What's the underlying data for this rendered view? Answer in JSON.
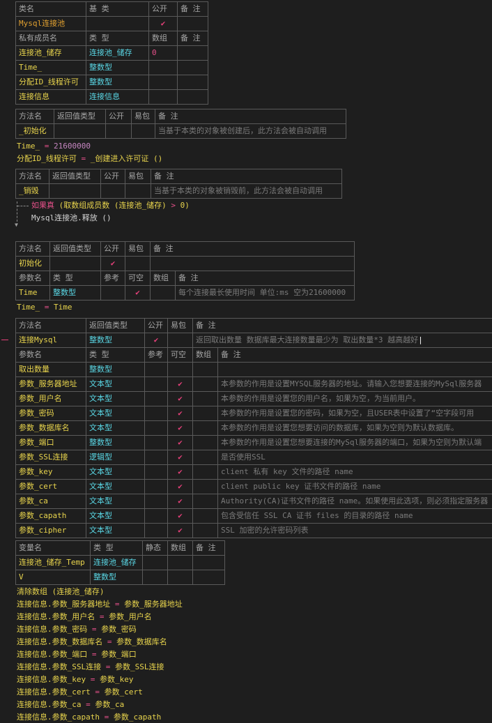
{
  "class_table": {
    "headers": [
      "类名",
      "基 类",
      "公开",
      "备 注"
    ],
    "row": {
      "name": "Mysql连接池",
      "base": "",
      "public": "✔",
      "note": ""
    }
  },
  "member_table": {
    "headers": [
      "私有成员名",
      "类 型",
      "数组",
      "备 注"
    ],
    "rows": [
      {
        "name": "连接池_储存",
        "type": "连接池_储存",
        "array": "0",
        "note": ""
      },
      {
        "name": "Time_",
        "type": "整数型",
        "array": "",
        "note": ""
      },
      {
        "name": "分配ID_线程许可",
        "type": "整数型",
        "array": "",
        "note": ""
      },
      {
        "name": "连接信息",
        "type": "连接信息",
        "array": "",
        "note": ""
      }
    ]
  },
  "method1": {
    "headers": [
      "方法名",
      "返回值类型",
      "公开",
      "易包",
      "备 注"
    ],
    "row": {
      "name": "_初始化",
      "ret": "",
      "public": "",
      "easy": "",
      "note": "当基于本类的对象被创建后，此方法会被自动调用"
    }
  },
  "code1": [
    {
      "a": "Time_",
      "op": " = ",
      "b": "21600000"
    },
    {
      "a": "分配ID_线程许可",
      "op": " = ",
      "b": "_创建进入许可证 ()"
    }
  ],
  "method2": {
    "headers": [
      "方法名",
      "返回值类型",
      "公开",
      "易包",
      "备 注"
    ],
    "row": {
      "name": "_销毁",
      "ret": "",
      "public": "",
      "easy": "",
      "note": "当基于本类的对象被销毁前，此方法会被自动调用"
    }
  },
  "code2": {
    "if_kw": "如果真",
    "if_expr": " (取数组成员数 (连接池_储存) ",
    "if_op": ">",
    "if_tail": " 0)",
    "body": "Mysql连接池.释放 ()"
  },
  "method3": {
    "headers": [
      "方法名",
      "返回值类型",
      "公开",
      "易包",
      "备 注"
    ],
    "row": {
      "name": "初始化",
      "ret": "",
      "public": "✔",
      "easy": "",
      "note": ""
    },
    "param_headers": [
      "参数名",
      "类 型",
      "参考",
      "可空",
      "数组",
      "备 注"
    ],
    "params": [
      {
        "name": "Time",
        "type": "整数型",
        "ref": "",
        "nullable": "✔",
        "array": "",
        "note": "每个连接最长使用时间 单位:ms 空为21600000"
      }
    ]
  },
  "code3": {
    "a": "Time_",
    "op": " = ",
    "b": "Time"
  },
  "method4": {
    "headers": [
      "方法名",
      "返回值类型",
      "公开",
      "易包",
      "备 注"
    ],
    "row": {
      "name": "连接Mysql",
      "ret": "整数型",
      "public": "✔",
      "easy": "",
      "note": "返回取出数量 数据库最大连接数量最少为 取出数量*3 越高越好"
    },
    "param_headers": [
      "参数名",
      "类 型",
      "参考",
      "可空",
      "数组",
      "备 注"
    ],
    "params": [
      {
        "name": "取出数量",
        "type": "整数型",
        "ref": "",
        "nullable": "",
        "array": "",
        "note": ""
      },
      {
        "name": "参数_服务器地址",
        "type": "文本型",
        "ref": "",
        "nullable": "✔",
        "array": "",
        "note": "本参数的作用是设置MYSQL服务器的地址。请输入您想要连接的MySql服务器"
      },
      {
        "name": "参数_用户名",
        "type": "文本型",
        "ref": "",
        "nullable": "✔",
        "array": "",
        "note": "本参数的作用是设置您的用户名，如果为空，为当前用户。"
      },
      {
        "name": "参数_密码",
        "type": "文本型",
        "ref": "",
        "nullable": "✔",
        "array": "",
        "note": "本参数的作用是设置您的密码，如果为空，且USER表中设置了“空字段可用"
      },
      {
        "name": "参数_数据库名",
        "type": "文本型",
        "ref": "",
        "nullable": "✔",
        "array": "",
        "note": "本参数的作用是设置您想要访问的数据库，如果为空则为默认数据库。"
      },
      {
        "name": "参数_端口",
        "type": "整数型",
        "ref": "",
        "nullable": "✔",
        "array": "",
        "note": "本参数的作用是设置您想要连接的MySql服务器的端口，如果为空则为默认端"
      },
      {
        "name": "参数_SSL连接",
        "type": "逻辑型",
        "ref": "",
        "nullable": "✔",
        "array": "",
        "note": "是否使用SSL"
      },
      {
        "name": "参数_key",
        "type": "文本型",
        "ref": "",
        "nullable": "✔",
        "array": "",
        "note": "client 私有 key 文件的路径 name"
      },
      {
        "name": "参数_cert",
        "type": "文本型",
        "ref": "",
        "nullable": "✔",
        "array": "",
        "note": "client public key 证书文件的路径 name"
      },
      {
        "name": "参数_ca",
        "type": "文本型",
        "ref": "",
        "nullable": "✔",
        "array": "",
        "note": "Authority(CA)证书文件的路径 name。如果使用此选项，则必须指定服务器"
      },
      {
        "name": "参数_capath",
        "type": "文本型",
        "ref": "",
        "nullable": "✔",
        "array": "",
        "note": "包含受信任 SSL CA 证书 files 的目录的路径 name"
      },
      {
        "name": "参数_cipher",
        "type": "文本型",
        "ref": "",
        "nullable": "✔",
        "array": "",
        "note": "SSL 加密的允许密码列表"
      }
    ]
  },
  "var_table": {
    "headers": [
      "变量名",
      "类 型",
      "静态",
      "数组",
      "备 注"
    ],
    "rows": [
      {
        "name": "连接池_储存_Temp",
        "type": "连接池_储存",
        "static": "",
        "array": "",
        "note": ""
      },
      {
        "name": "V",
        "type": "整数型",
        "static": "",
        "array": "",
        "note": ""
      }
    ]
  },
  "code4": [
    {
      "a": "清除数组 (连接池_储存)",
      "op": "",
      "b": ""
    },
    {
      "a": "连接信息.参数_服务器地址",
      "op": " = ",
      "b": "参数_服务器地址"
    },
    {
      "a": "连接信息.参数_用户名",
      "op": " = ",
      "b": "参数_用户名"
    },
    {
      "a": "连接信息.参数_密码",
      "op": " = ",
      "b": "参数_密码"
    },
    {
      "a": "连接信息.参数_数据库名",
      "op": " = ",
      "b": "参数_数据库名"
    },
    {
      "a": "连接信息.参数_端口",
      "op": " = ",
      "b": "参数_端口"
    },
    {
      "a": "连接信息.参数_SSL连接",
      "op": " = ",
      "b": "参数_SSL连接"
    },
    {
      "a": "连接信息.参数_key",
      "op": " = ",
      "b": "参数_key"
    },
    {
      "a": "连接信息.参数_cert",
      "op": " = ",
      "b": "参数_cert"
    },
    {
      "a": "连接信息.参数_ca",
      "op": " = ",
      "b": "参数_ca"
    },
    {
      "a": "连接信息.参数_capath",
      "op": " = ",
      "b": "参数_capath"
    }
  ]
}
